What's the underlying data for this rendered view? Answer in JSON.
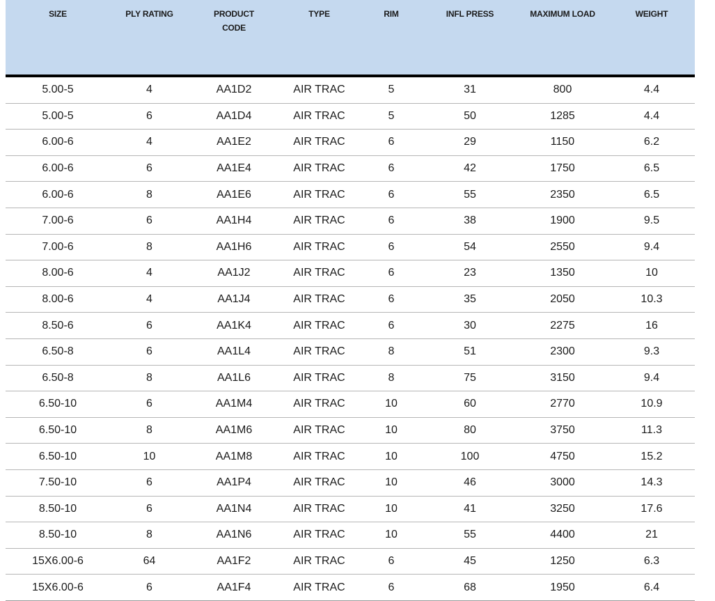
{
  "table": {
    "headers": [
      {
        "key": "size",
        "label": "SIZE"
      },
      {
        "key": "ply",
        "label": "PLY RATING"
      },
      {
        "key": "code",
        "label": "PRODUCT CODE",
        "lines": [
          "PRODUCT",
          "CODE"
        ]
      },
      {
        "key": "type",
        "label": "TYPE"
      },
      {
        "key": "rim",
        "label": "RIM"
      },
      {
        "key": "infl",
        "label": "INFL PRESS"
      },
      {
        "key": "load",
        "label": "MAXIMUM LOAD"
      },
      {
        "key": "weight",
        "label": "WEIGHT"
      }
    ],
    "rows": [
      [
        "5.00-5",
        "4",
        "AA1D2",
        "AIR TRAC",
        "5",
        "31",
        "800",
        "4.4"
      ],
      [
        "5.00-5",
        "6",
        "AA1D4",
        "AIR TRAC",
        "5",
        "50",
        "1285",
        "4.4"
      ],
      [
        "6.00-6",
        "4",
        "AA1E2",
        "AIR TRAC",
        "6",
        "29",
        "1150",
        "6.2"
      ],
      [
        "6.00-6",
        "6",
        "AA1E4",
        "AIR TRAC",
        "6",
        "42",
        "1750",
        "6.5"
      ],
      [
        "6.00-6",
        "8",
        "AA1E6",
        "AIR TRAC",
        "6",
        "55",
        "2350",
        "6.5"
      ],
      [
        "7.00-6",
        "6",
        "AA1H4",
        "AIR TRAC",
        "6",
        "38",
        "1900",
        "9.5"
      ],
      [
        "7.00-6",
        "8",
        "AA1H6",
        "AIR TRAC",
        "6",
        "54",
        "2550",
        "9.4"
      ],
      [
        "8.00-6",
        "4",
        "AA1J2",
        "AIR TRAC",
        "6",
        "23",
        "1350",
        "10"
      ],
      [
        "8.00-6",
        "4",
        "AA1J4",
        "AIR TRAC",
        "6",
        "35",
        "2050",
        "10.3"
      ],
      [
        "8.50-6",
        "6",
        "AA1K4",
        "AIR TRAC",
        "6",
        "30",
        "2275",
        "16"
      ],
      [
        "6.50-8",
        "6",
        "AA1L4",
        "AIR TRAC",
        "8",
        "51",
        "2300",
        "9.3"
      ],
      [
        "6.50-8",
        "8",
        "AA1L6",
        "AIR TRAC",
        "8",
        "75",
        "3150",
        "9.4"
      ],
      [
        "6.50-10",
        "6",
        "AA1M4",
        "AIR TRAC",
        "10",
        "60",
        "2770",
        "10.9"
      ],
      [
        "6.50-10",
        "8",
        "AA1M6",
        "AIR TRAC",
        "10",
        "80",
        "3750",
        "11.3"
      ],
      [
        "6.50-10",
        "10",
        "AA1M8",
        "AIR TRAC",
        "10",
        "100",
        "4750",
        "15.2"
      ],
      [
        "7.50-10",
        "6",
        "AA1P4",
        "AIR TRAC",
        "10",
        "46",
        "3000",
        "14.3"
      ],
      [
        "8.50-10",
        "6",
        "AA1N4",
        "AIR TRAC",
        "10",
        "41",
        "3250",
        "17.6"
      ],
      [
        "8.50-10",
        "8",
        "AA1N6",
        "AIR TRAC",
        "10",
        "55",
        "4400",
        "21"
      ],
      [
        "15X6.00-6",
        "64",
        "AA1F2",
        "AIR TRAC",
        "6",
        "45",
        "1250",
        "6.3"
      ],
      [
        "15X6.00-6",
        "6",
        "AA1F4",
        "AIR TRAC",
        "6",
        "68",
        "1950",
        "6.4"
      ]
    ]
  },
  "colors": {
    "header_background": "#c5d9ef",
    "header_rule": "#000000",
    "row_divider": "#b5b5b5"
  }
}
